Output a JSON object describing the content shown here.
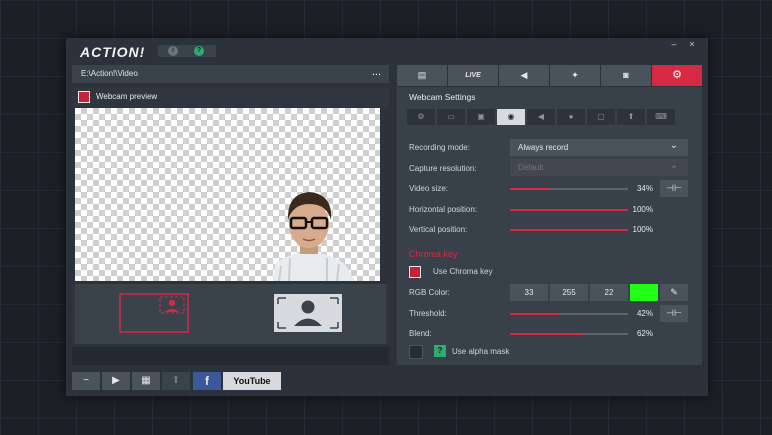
{
  "app": {
    "logo": "ACTION!",
    "info_glyph": "i",
    "help_glyph": "?",
    "minimize_glyph": "–",
    "close_glyph": "×"
  },
  "left": {
    "path": "E:\\Action!\\Video",
    "more_glyph": "...",
    "preview_label": "Webcam preview"
  },
  "bottombar": {
    "buttons": [
      "−",
      "▶",
      "▦",
      "⬆"
    ],
    "facebook_label": "f",
    "youtube_label": "YouTube"
  },
  "tabs": [
    {
      "name": "video",
      "label": "▤"
    },
    {
      "name": "live",
      "label": "LIVE"
    },
    {
      "name": "audio",
      "label": "◀"
    },
    {
      "name": "gameplay",
      "label": "✦"
    },
    {
      "name": "screenshot",
      "label": "◙"
    },
    {
      "name": "settings",
      "label": "⚙"
    }
  ],
  "panel": {
    "title": "Webcam Settings",
    "subtabs": [
      "⚙",
      "▭",
      "▣",
      "◉",
      "◀",
      "●",
      "▢",
      "⬆",
      "⌨"
    ],
    "recording_mode": {
      "label": "Recording mode:",
      "value": "Always record"
    },
    "capture_resolution": {
      "label": "Capture resolution:",
      "value": "Default"
    },
    "video_size": {
      "label": "Video size:",
      "value": 34,
      "display": "34%"
    },
    "horizontal_position": {
      "label": "Horizontal position:",
      "value": 100,
      "display": "100%"
    },
    "vertical_position": {
      "label": "Vertical position:",
      "value": 100,
      "display": "100%"
    },
    "chroma": {
      "section": "Chroma key",
      "use_label": "Use Chroma key",
      "rgb_label": "RGB Color:",
      "r": "33",
      "g": "255",
      "b": "22",
      "swatch_color": "#21ff16",
      "threshold": {
        "label": "Threshold:",
        "value": 42,
        "display": "42%"
      },
      "blend": {
        "label": "Blend:",
        "value": 62,
        "display": "62%"
      },
      "alpha_label": "Use alpha mask",
      "alpha_help": "?"
    }
  },
  "colors": {
    "accent": "#d62a44",
    "help_green": "#2eaa72",
    "facebook": "#3b5998"
  }
}
